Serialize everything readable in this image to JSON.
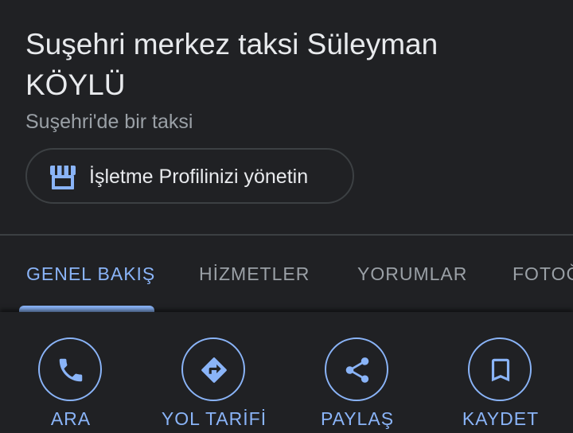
{
  "place": {
    "title": "Suşehri merkez taksi Süleyman KÖYLÜ",
    "category": "Suşehri'de bir taksi"
  },
  "manage_profile": {
    "label": "İşletme Profilinizi yönetin",
    "icon": "storefront-icon"
  },
  "tabs": [
    {
      "label": "GENEL BAKIŞ",
      "active": true
    },
    {
      "label": "HİZMETLER",
      "active": false
    },
    {
      "label": "YORUMLAR",
      "active": false
    },
    {
      "label": "FOTOĞRAFLAR",
      "active": false
    }
  ],
  "actions": [
    {
      "label": "ARA",
      "icon": "phone-icon"
    },
    {
      "label": "YOL TARİFİ",
      "icon": "directions-icon"
    },
    {
      "label": "PAYLAŞ",
      "icon": "share-icon"
    },
    {
      "label": "KAYDET",
      "icon": "bookmark-icon"
    }
  ],
  "colors": {
    "background": "#202124",
    "accent": "#8ab4f8",
    "primary_text": "#e8eaed",
    "secondary_text": "#9aa0a6",
    "divider": "#3c4043"
  }
}
